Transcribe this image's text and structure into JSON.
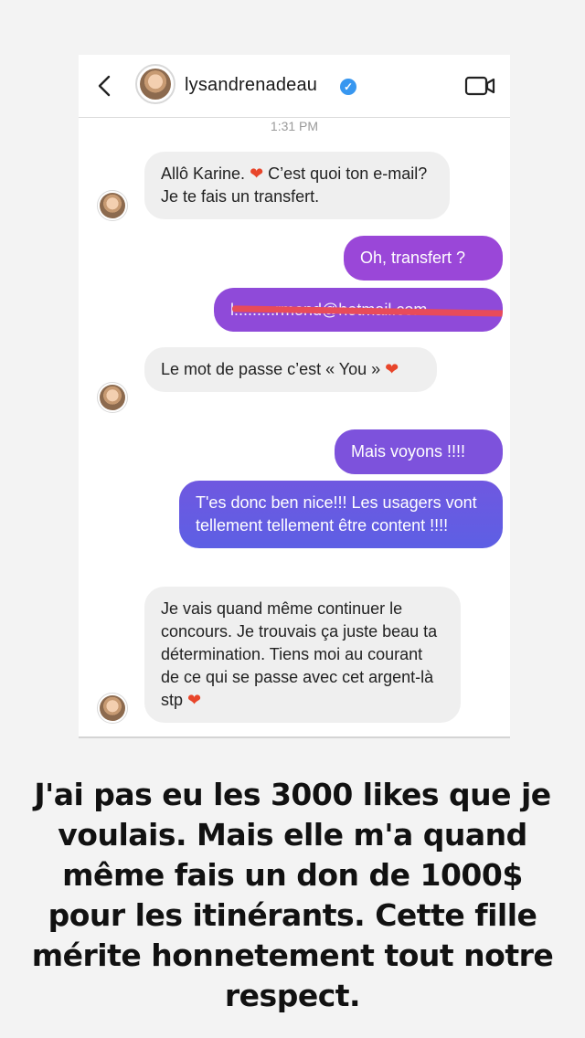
{
  "header": {
    "username": "lysandrenadeau",
    "verified_mark": "✓",
    "back_icon": "chevron-left-icon",
    "video_icon": "video-camera-icon"
  },
  "timestamp": "1:31 PM",
  "messages": [
    {
      "side": "received",
      "text": "Allô Karine. ❤️ C’est quoi ton e-mail? Je te fais un transfert."
    },
    {
      "side": "sent",
      "text": "Oh, transfert ?"
    },
    {
      "side": "sent",
      "text": "l.........rmond@hotmail.com"
    },
    {
      "side": "received",
      "text": "Le mot de passe c’est « You » ❤️"
    },
    {
      "side": "sent",
      "text": "Mais voyons !!!!"
    },
    {
      "side": "sent",
      "text": "T'es donc ben nice!!! Les usagers vont tellement tellement être content !!!!"
    },
    {
      "side": "received",
      "text": "Je vais quand même continuer le concours. Je trouvais ça juste beau ta détermination. Tiens moi au courant de ce qui se passe avec cet argent-là stp ❤️"
    }
  ],
  "caption": "J'ai pas eu les 3000 likes que je voulais. Mais elle m'a quand même fais un don de 1000$ pour les itinérants. Cette fille mérite honnetement tout notre respect.",
  "colors": {
    "received_bubble": "#efefef",
    "sent_gradient_top": "#9a47d8",
    "sent_gradient_bottom": "#5d5fe4",
    "heart": "#e8452a",
    "verified": "#3897f0"
  }
}
